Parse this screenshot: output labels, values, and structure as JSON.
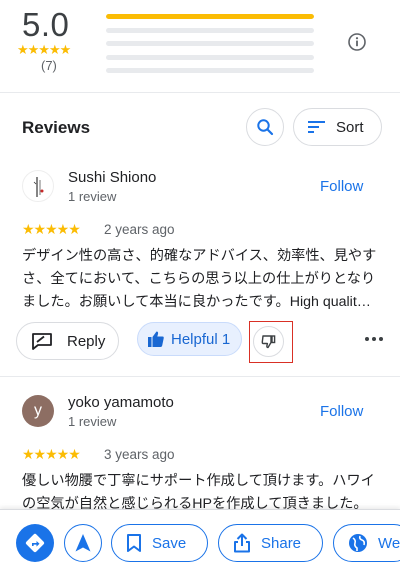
{
  "summary": {
    "rating": "5.0",
    "stars": "★★★★★",
    "count": "(7)",
    "distribution": [
      {
        "stars": 5,
        "fraction": 1.0
      },
      {
        "stars": 4,
        "fraction": 0.0
      },
      {
        "stars": 3,
        "fraction": 0.0
      },
      {
        "stars": 2,
        "fraction": 0.0
      },
      {
        "stars": 1,
        "fraction": 0.0
      }
    ]
  },
  "reviews_header": {
    "title": "Reviews",
    "sort_label": "Sort"
  },
  "reviews": [
    {
      "name": "Sushi Shiono",
      "meta": "1 review",
      "follow": "Follow",
      "stars": "★★★★★",
      "ago": "2 years ago",
      "text": "デザイン性の高さ、的確なアドバイス、効率性、見やすさ、全てにおいて、こちらの思う以上の仕上がりとなりました。お願いして本当に良かったです。High qualit…",
      "reply_label": "Reply",
      "helpful_label": "Helpful 1"
    },
    {
      "name": "yoko yamamoto",
      "avatar_initial": "y",
      "meta": "1 review",
      "follow": "Follow",
      "stars": "★★★★★",
      "ago": "3 years ago",
      "text": "優しい物腰で丁寧にサポート作成して頂けます。ハワイの空気が自然と感じられるHPを作成して頂きました。"
    }
  ],
  "bottom_bar": {
    "save_label": "Save",
    "share_label": "Share",
    "website_label": "We"
  },
  "colors": {
    "accent": "#1a73e8",
    "star": "#fbbc04",
    "highlight": "#d93025"
  }
}
